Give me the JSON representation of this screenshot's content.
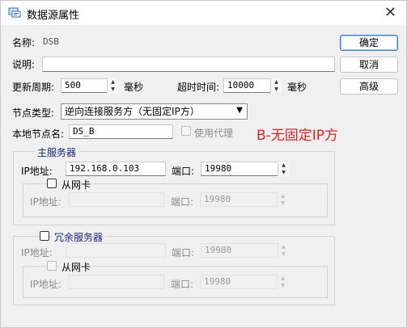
{
  "window": {
    "title": "数据源属性",
    "close_glyph": "✕"
  },
  "form": {
    "name_label": "名称:",
    "name_value": "DSB",
    "desc_label": "说明:",
    "desc_value": "",
    "refresh_label": "更新周期:",
    "refresh_value": "500",
    "refresh_unit": "毫秒",
    "timeout_label": "超时时间:",
    "timeout_value": "10000",
    "timeout_unit": "毫秒",
    "node_type_label": "节点类型:",
    "node_type_value": "逆向连接服务方（无固定IP方）",
    "local_node_label": "本地节点名:",
    "local_node_value": "DS_B",
    "use_proxy_label": "使用代理"
  },
  "buttons": {
    "ok": "确定",
    "cancel": "取消",
    "advanced": "高级"
  },
  "annotation": {
    "text": "B-无固定IP方",
    "color": "#e02020"
  },
  "main_server": {
    "legend": "主服务器",
    "ip_label": "IP地址:",
    "ip_value": "192.168.0.103",
    "port_label": "端口:",
    "port_value": "19980",
    "slave_nic": {
      "legend": "从网卡",
      "ip_label": "IP地址:",
      "ip_value": "",
      "port_label": "端口:",
      "port_value": "19980"
    }
  },
  "redundant_server": {
    "legend": "冗余服务器",
    "ip_label": "IP地址:",
    "ip_value": "",
    "port_label": "端口:",
    "port_value": "19980",
    "slave_nic": {
      "legend": "从网卡",
      "ip_label": "IP地址:",
      "ip_value": "",
      "port_label": "端口:",
      "port_value": "19980"
    }
  },
  "colors": {
    "legend_blue": "#1a237e",
    "annotation_red": "#e02020"
  }
}
